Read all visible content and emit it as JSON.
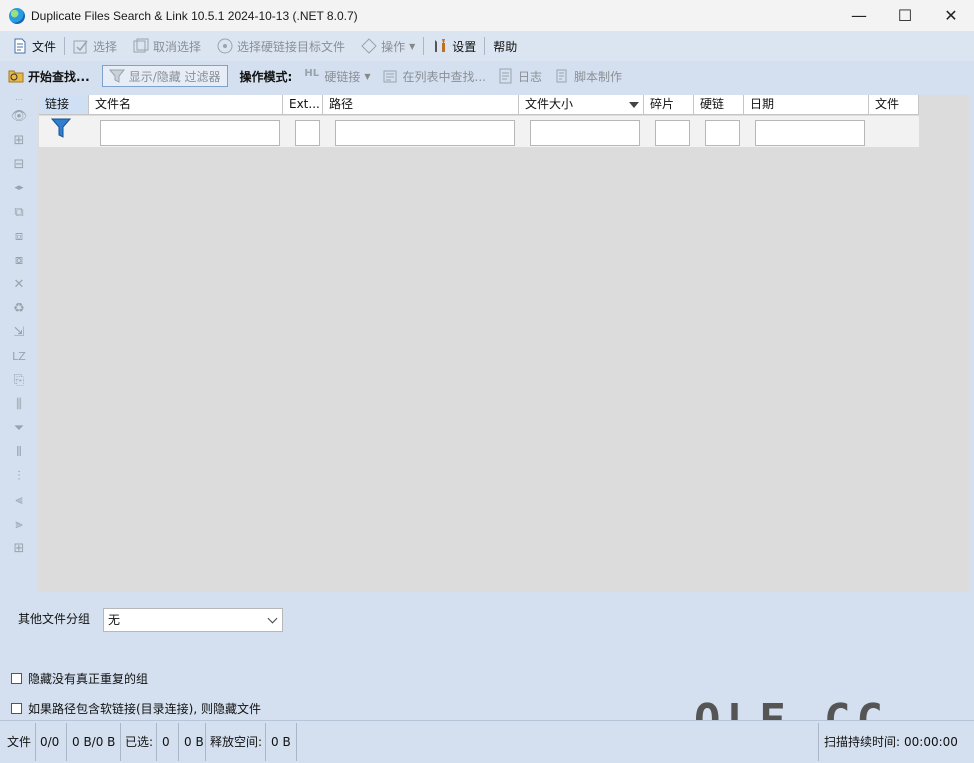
{
  "window": {
    "title": "Duplicate Files Search & Link 10.5.1 2024-10-13 (.NET 8.0.7)",
    "minimize_glyph": "—",
    "maximize_glyph": "☐",
    "close_glyph": "✕"
  },
  "menu": {
    "file": "文件",
    "select": "选择",
    "deselect": "取消选择",
    "select_hardlink_targets": "选择硬链接目标文件",
    "operations": "操作",
    "settings": "设置",
    "help": "帮助"
  },
  "toolbar": {
    "start_search": "开始查找...",
    "toggle_filter": "显示/隐藏 过滤器",
    "op_mode_label": "操作模式:",
    "hardlink": "硬链接",
    "find_in_list": "在列表中查找...",
    "log": "日志",
    "script": "脚本制作"
  },
  "left_toolbar": {
    "lz_label": "LZ"
  },
  "grid": {
    "columns": [
      "链接",
      "文件名",
      "Ext...",
      "路径",
      "文件大小",
      "碎片",
      "硬链",
      "日期",
      "文件"
    ]
  },
  "other_group": {
    "label": "其他文件分组",
    "value": "无"
  },
  "options": {
    "hide_no_real_dup": "隐藏没有真正重复的组",
    "hide_symlink_paths": "如果路径包含软链接(目录连接), 则隐藏文件"
  },
  "watermark": "OLF.CC",
  "status": {
    "files_label": "文件",
    "files_count": "0/0",
    "size": "0 B/0 B",
    "selected_label": "已选:",
    "selected_count": "0",
    "selected_size": "0 B",
    "free_label": "释放空间:",
    "free_value": "0 B",
    "scan_duration_label": "扫描持续时间:",
    "scan_duration_value": "00:00:00"
  }
}
